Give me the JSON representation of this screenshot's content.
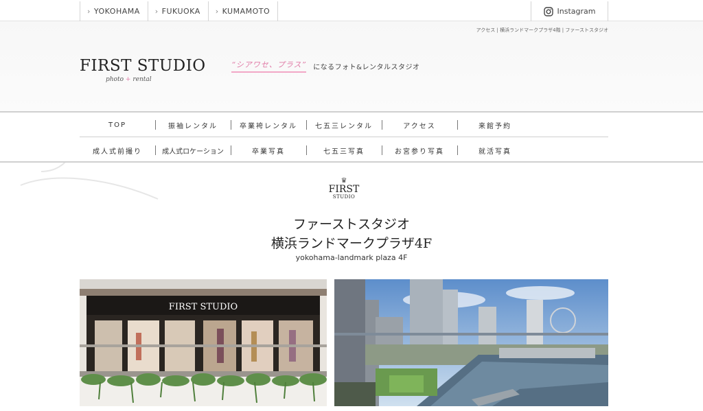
{
  "topbar": {
    "cities": [
      {
        "label": "YOKOHAMA",
        "icon": "chevron-right-icon"
      },
      {
        "label": "FUKUOKA",
        "icon": "chevron-right-icon"
      },
      {
        "label": "KUMAMOTO",
        "icon": "chevron-right-icon"
      }
    ],
    "instagram_label": "Instagram"
  },
  "header": {
    "breadcrumb": "アクセス | 横浜ランドマークプラザ4階 | ファーストスタジオ",
    "logo_main": "FIRST STUDIO",
    "logo_sub_left": "photo",
    "logo_sub_plus": "+",
    "logo_sub_right": "rental",
    "tagline_pink": "“シアワセ、プラス”",
    "tagline_rest": "になるフォト&レンタルスタジオ"
  },
  "nav": {
    "row1": [
      "TOP",
      "振袖レンタル",
      "卒業袴レンタル",
      "七五三レンタル",
      "アクセス",
      "来館予約"
    ],
    "row2": [
      "成人式前撮り",
      "成人式ロケーション",
      "卒業写真",
      "七五三写真",
      "お宮参り写真",
      "就活写真"
    ]
  },
  "content": {
    "emblem_first": "FIRST",
    "emblem_studio": "STUDIO",
    "title_line1": "ファーストスタジオ",
    "title_line2": "横浜ランドマークプラザ4F",
    "subtitle": "yokohama-landmark plaza 4F",
    "store_sign": "FIRST STUDIO"
  },
  "colors": {
    "accent_pink": "#e07aa6",
    "border_gray": "#d0d0d0"
  }
}
